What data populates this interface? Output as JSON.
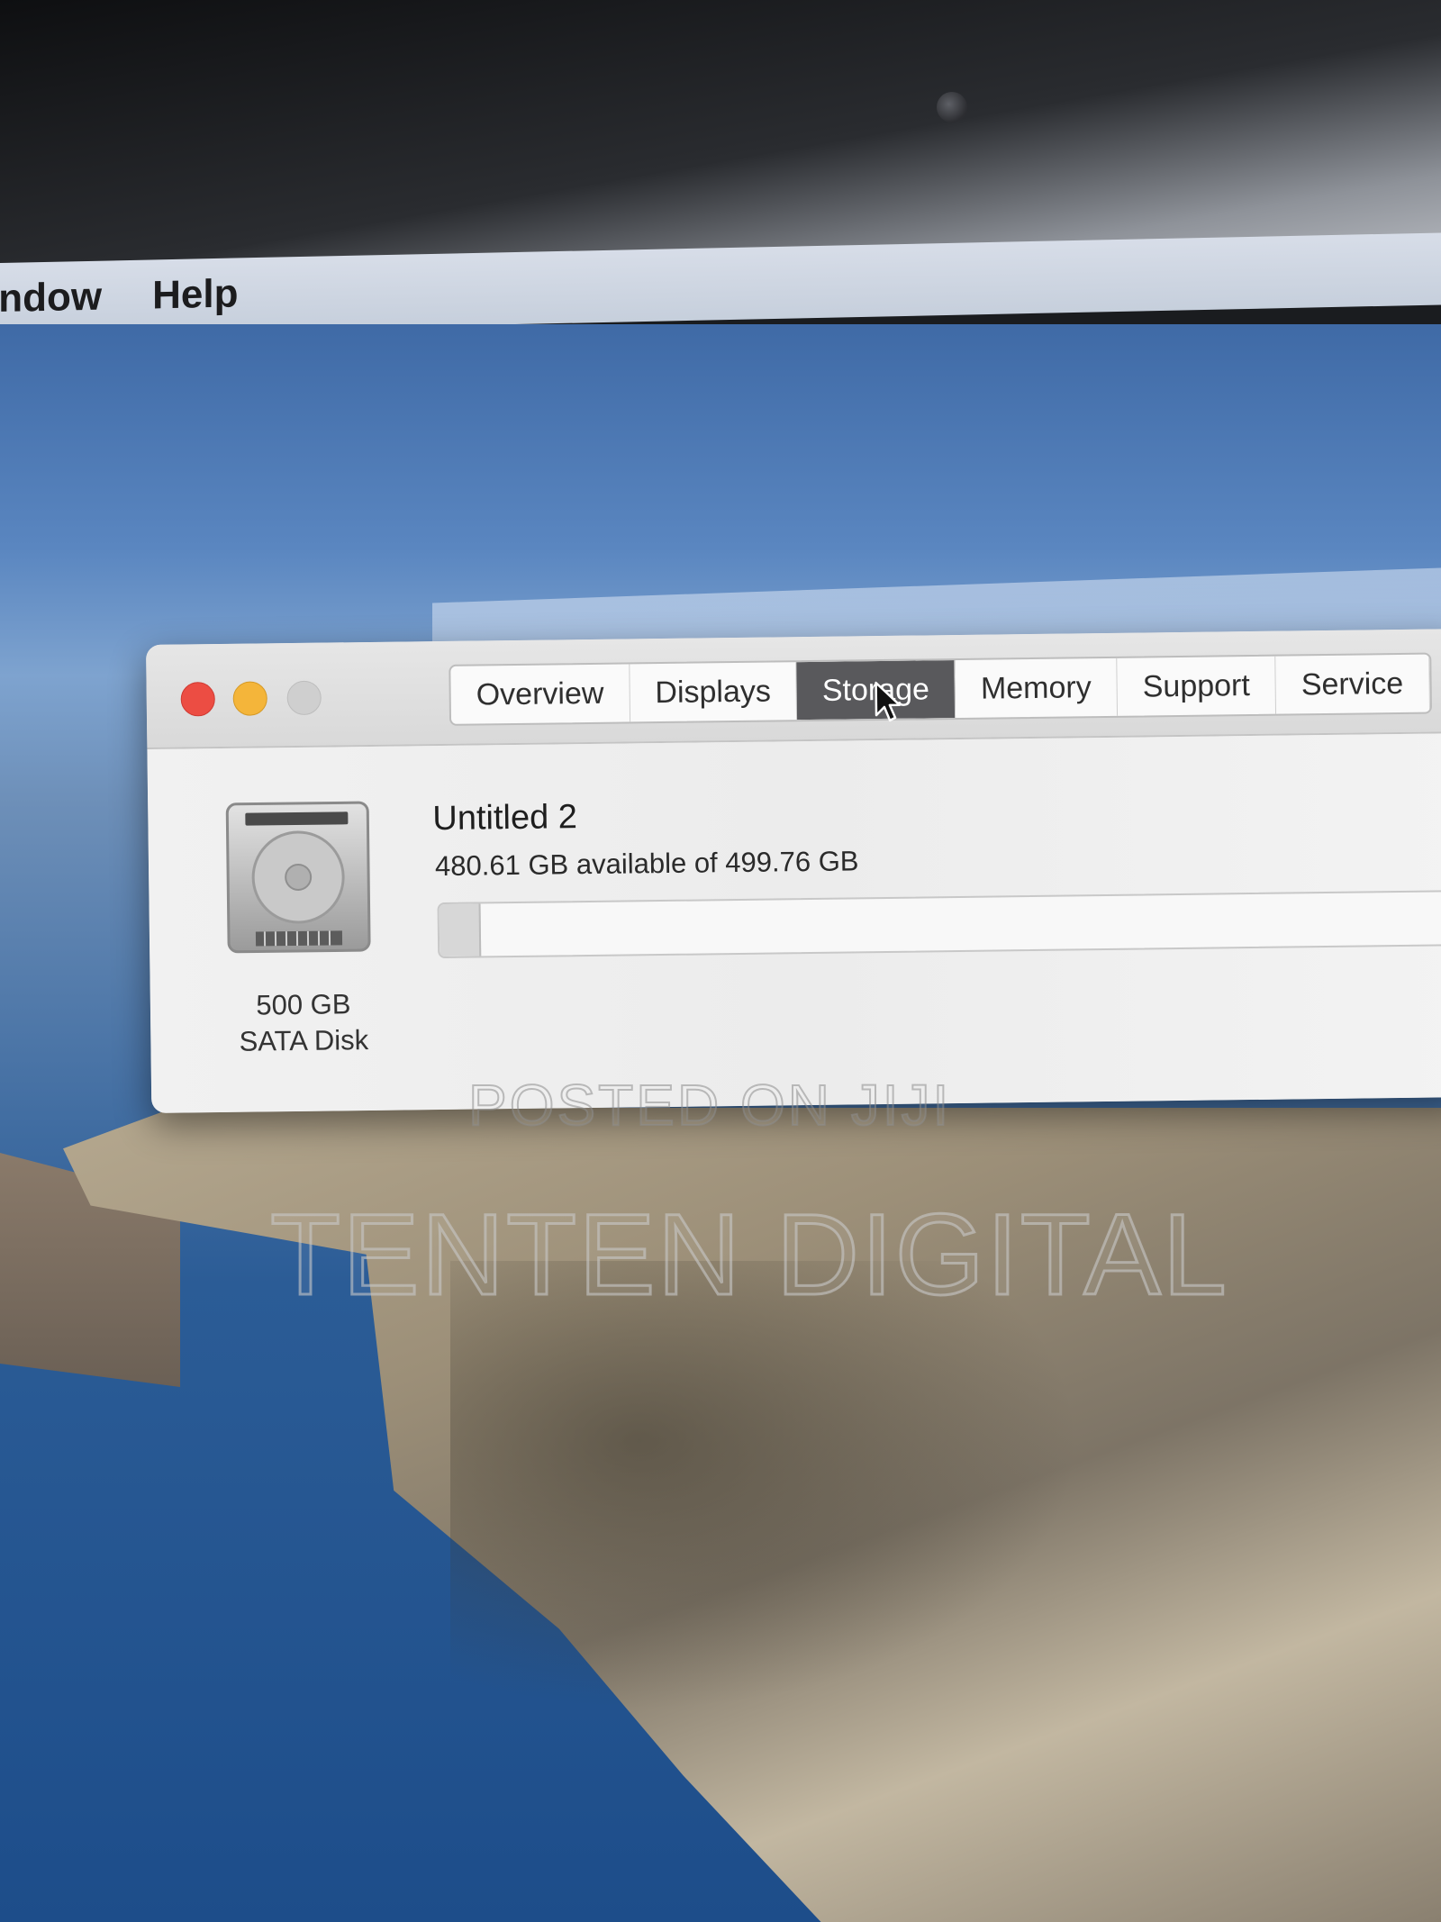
{
  "menubar": {
    "items": [
      "indow",
      "Help"
    ]
  },
  "window": {
    "tabs": [
      "Overview",
      "Displays",
      "Storage",
      "Memory",
      "Support",
      "Service"
    ],
    "active_tab": "Storage",
    "disk": {
      "size": "500 GB",
      "type": "SATA Disk"
    },
    "volume": {
      "name": "Untitled 2",
      "availability": "480.61 GB available of 499.76 GB",
      "used_fraction": 0.038
    }
  },
  "watermarks": {
    "line1": "POSTED ON JIJI",
    "line2": "TENTEN DIGITAL"
  },
  "colors": {
    "close": "#ec4d43",
    "minimize": "#f4b53a",
    "zoom_disabled": "#cfcfcf",
    "active_tab": "#59595c"
  }
}
